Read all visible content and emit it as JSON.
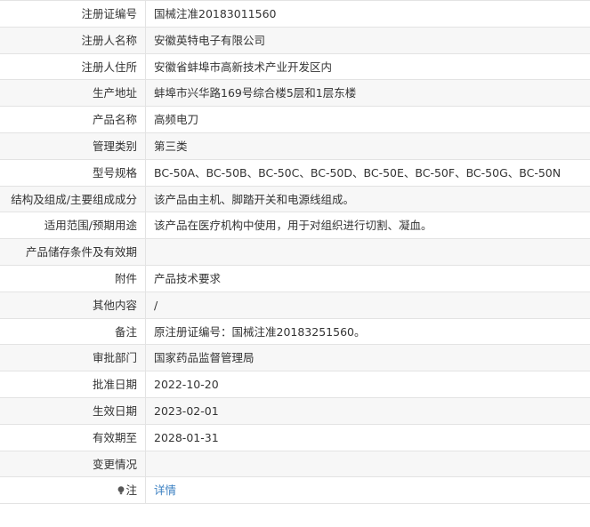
{
  "rows": [
    {
      "label": "注册证编号",
      "value": "国械注准20183011560"
    },
    {
      "label": "注册人名称",
      "value": "安徽英特电子有限公司"
    },
    {
      "label": "注册人住所",
      "value": "安徽省蚌埠市高新技术产业开发区内"
    },
    {
      "label": "生产地址",
      "value": "蚌埠市兴华路169号综合楼5层和1层东楼"
    },
    {
      "label": "产品名称",
      "value": "高频电刀"
    },
    {
      "label": "管理类别",
      "value": "第三类"
    },
    {
      "label": "型号规格",
      "value": "BC-50A、BC-50B、BC-50C、BC-50D、BC-50E、BC-50F、BC-50G、BC-50N"
    },
    {
      "label": "结构及组成/主要组成成分",
      "value": "该产品由主机、脚踏开关和电源线组成。"
    },
    {
      "label": "适用范围/预期用途",
      "value": "该产品在医疗机构中使用，用于对组织进行切割、凝血。"
    },
    {
      "label": "产品储存条件及有效期",
      "value": ""
    },
    {
      "label": "附件",
      "value": "产品技术要求"
    },
    {
      "label": "其他内容",
      "value": "/"
    },
    {
      "label": "备注",
      "value": "原注册证编号：国械注准20183251560。"
    },
    {
      "label": "审批部门",
      "value": "国家药品监督管理局"
    },
    {
      "label": "批准日期",
      "value": "2022-10-20"
    },
    {
      "label": "生效日期",
      "value": "2023-02-01"
    },
    {
      "label": "有效期至",
      "value": "2028-01-31"
    },
    {
      "label": "变更情况",
      "value": ""
    },
    {
      "label": "注",
      "value": "详情",
      "icon": "lightbulb-icon"
    }
  ],
  "colors": {
    "border": "#e3e3e3",
    "alt_row_bg": "#f7f7f7",
    "text": "#333333",
    "link": "#3a7fc1"
  }
}
